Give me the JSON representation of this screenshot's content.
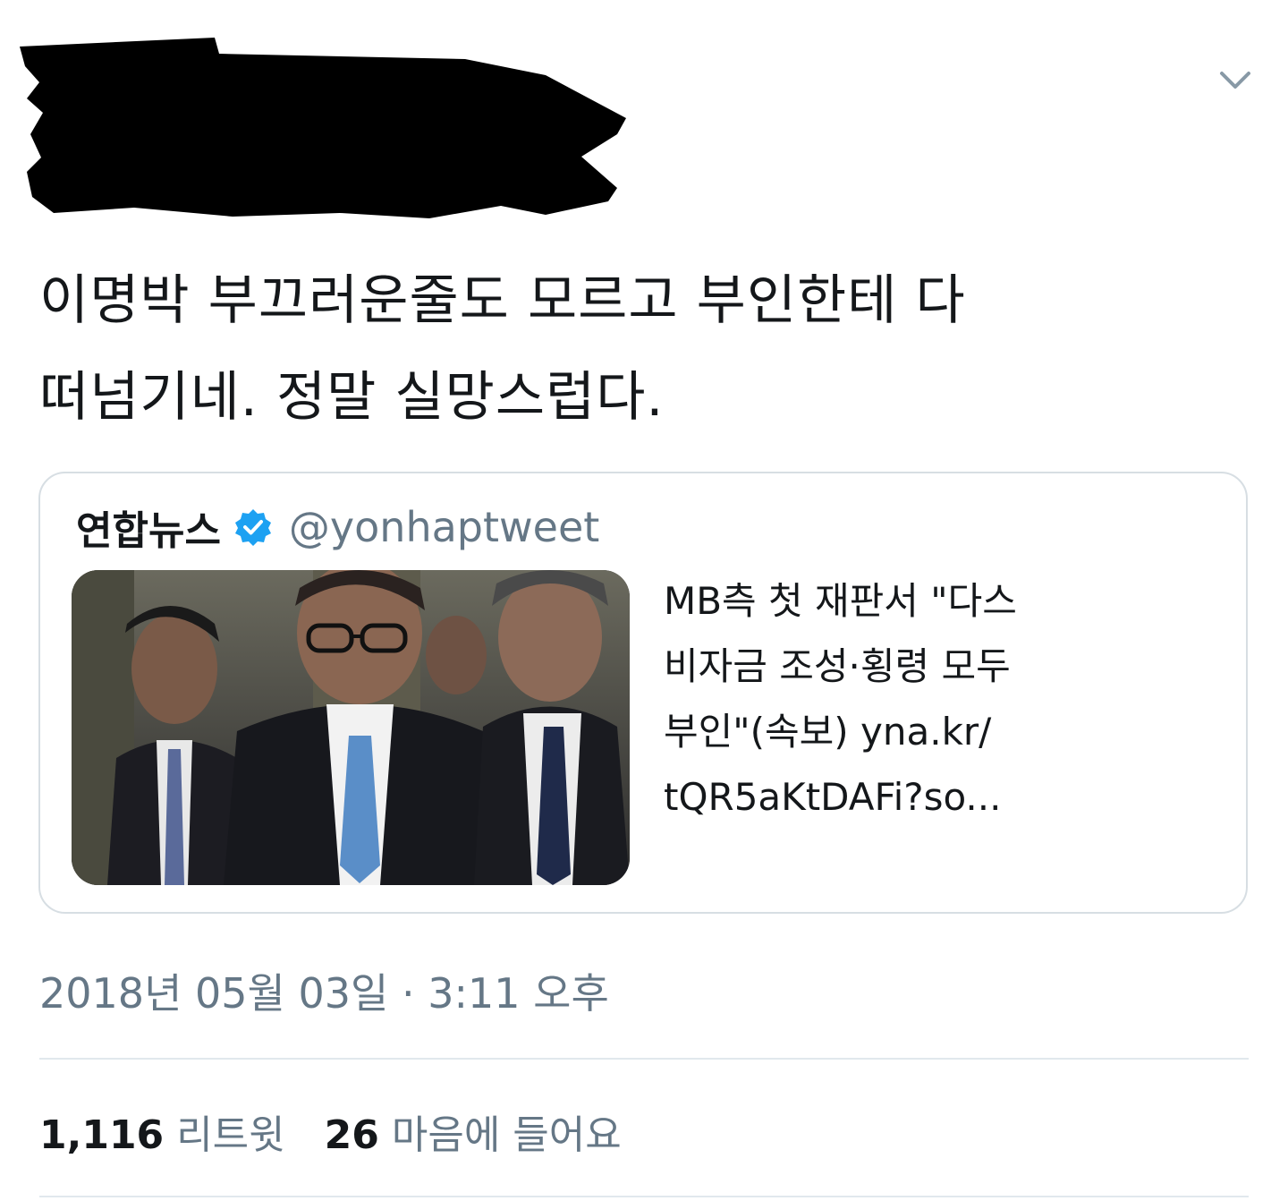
{
  "author": {
    "redacted": true
  },
  "tweet": {
    "text_line1": "이명박 부끄러운줄도 모르고 부인한테 다",
    "text_line2": "떠넘기네. 정말 실망스럽다."
  },
  "quoted_tweet": {
    "name": "연합뉴스",
    "verified": true,
    "handle": "@yonhaptweet",
    "text_lines": [
      "MB측 첫 재판서 \"다스",
      "비자금 조성·횡령 모두",
      "부인\"(속보) yna.kr/",
      "tQR5aKtDAFi?so..."
    ]
  },
  "timestamp": "2018년 05월 03일 · 3:11 오후",
  "stats": {
    "retweets_count": "1,116",
    "retweets_label": "리트윗",
    "likes_count": "26",
    "likes_label": "마음에 들어요"
  },
  "colors": {
    "text": "#14171a",
    "secondary": "#657786",
    "verified_blue": "#1da1f2",
    "border": "#d7dee3",
    "divider": "#e1e8ed"
  },
  "icons": {
    "caret": "chevron-down-icon",
    "verified": "verified-badge-icon"
  }
}
